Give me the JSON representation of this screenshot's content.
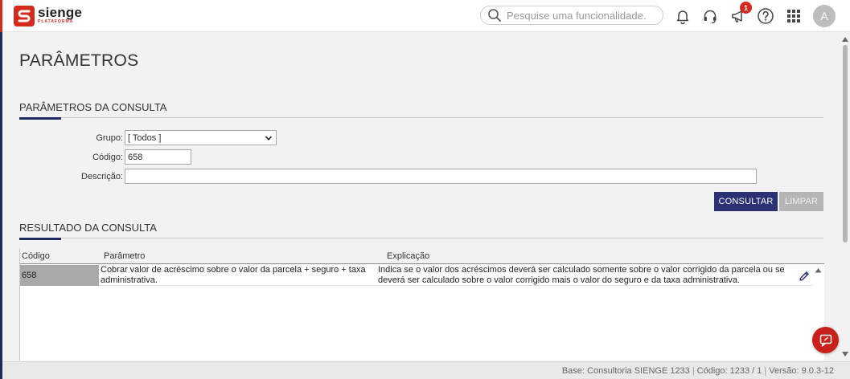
{
  "header": {
    "brand_name": "sienge",
    "brand_sub": "PLATAFORMA",
    "search_placeholder": "Pesquise uma funcionalidade.",
    "notification_count": "1",
    "avatar_initial": "A"
  },
  "page": {
    "title": "PARÂMETROS"
  },
  "filter": {
    "section_title": "PARÂMETROS DA CONSULTA",
    "grupo_label": "Grupo:",
    "grupo_value": "[ Todos ]",
    "codigo_label": "Código:",
    "codigo_value": "658",
    "descricao_label": "Descrição:",
    "descricao_value": "",
    "consultar_label": "CONSULTAR",
    "limpar_label": "LIMPAR"
  },
  "results": {
    "section_title": "RESULTADO DA CONSULTA",
    "columns": {
      "codigo": "Código",
      "parametro": "Parâmetro",
      "explicacao": "Explicação"
    },
    "rows": [
      {
        "codigo": "658",
        "parametro": "Cobrar valor de acréscimo sobre o valor da parcela + seguro + taxa administrativa.",
        "explicacao": "Indica se o valor dos acréscimos deverá ser calculado somente sobre o valor corrigido da parcela ou se deverá ser calculado sobre o valor corrigido mais o valor do seguro e da taxa administrativa."
      }
    ]
  },
  "footer": {
    "base": "Base: Consultoria SIENGE 1233",
    "codigo": "Código: 1233 / 1",
    "versao": "Versão: 9.0.3-12"
  },
  "colors": {
    "brand_red": "#d52b1e",
    "primary_navy": "#2b3172",
    "accent_navy": "#1f2a5c"
  }
}
